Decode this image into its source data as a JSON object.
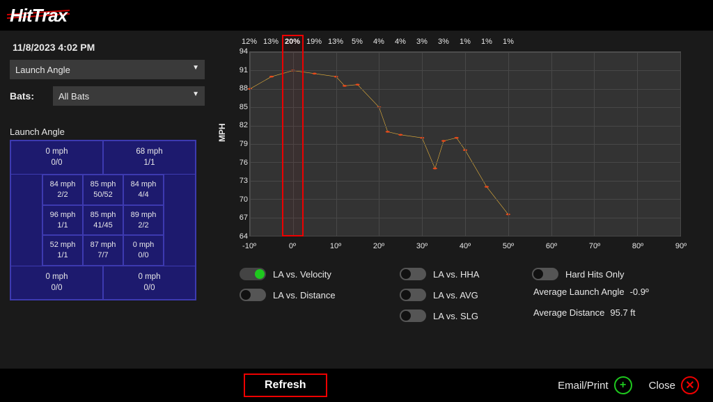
{
  "logo_text": "HitTrax",
  "timestamp": "11/8/2023 4:02 PM",
  "metric_select": "Launch Angle",
  "bats_label": "Bats:",
  "bats_select": "All Bats",
  "zone_title": "Launch Angle",
  "zone": {
    "top": [
      {
        "v": "0 mph",
        "c": "0/0"
      },
      {
        "v": "68 mph",
        "c": "1/1"
      }
    ],
    "inner": [
      [
        {
          "v": "84 mph",
          "c": "2/2"
        },
        {
          "v": "85 mph",
          "c": "50/52"
        },
        {
          "v": "84 mph",
          "c": "4/4"
        }
      ],
      [
        {
          "v": "96 mph",
          "c": "1/1"
        },
        {
          "v": "85 mph",
          "c": "41/45"
        },
        {
          "v": "89 mph",
          "c": "2/2"
        }
      ],
      [
        {
          "v": "52 mph",
          "c": "1/1"
        },
        {
          "v": "87 mph",
          "c": "7/7"
        },
        {
          "v": "0 mph",
          "c": "0/0"
        }
      ]
    ],
    "bottom": [
      {
        "v": "0 mph",
        "c": "0/0"
      },
      {
        "v": "0 mph",
        "c": "0/0"
      }
    ]
  },
  "toggles": {
    "la_velocity": "LA vs. Velocity",
    "la_distance": "LA vs. Distance",
    "la_hha": "LA vs. HHA",
    "la_avg": "LA vs. AVG",
    "la_slg": "LA vs. SLG",
    "hard_hits": "Hard Hits Only"
  },
  "stats": {
    "avg_la_label": "Average Launch Angle",
    "avg_la_value": "-0.9º",
    "avg_dist_label": "Average Distance",
    "avg_dist_value": "95.7 ft"
  },
  "footer": {
    "refresh": "Refresh",
    "email": "Email/Print",
    "close": "Close"
  },
  "chart_data": {
    "type": "line",
    "title": "",
    "ylabel": "MPH",
    "xlabel": "",
    "x_range": [
      -10,
      90
    ],
    "y_range": [
      64,
      94
    ],
    "x_ticks": [
      -10,
      0,
      10,
      20,
      30,
      40,
      50,
      60,
      70,
      80,
      90
    ],
    "y_ticks": [
      64,
      67,
      70,
      73,
      76,
      79,
      82,
      85,
      88,
      91,
      94
    ],
    "pct_labels": [
      {
        "x": -10,
        "label": "12%"
      },
      {
        "x": -5,
        "label": "13%"
      },
      {
        "x": 0,
        "label": "20%",
        "highlight": true
      },
      {
        "x": 5,
        "label": "19%"
      },
      {
        "x": 10,
        "label": "13%"
      },
      {
        "x": 15,
        "label": "5%"
      },
      {
        "x": 20,
        "label": "4%"
      },
      {
        "x": 25,
        "label": "4%"
      },
      {
        "x": 30,
        "label": "3%"
      },
      {
        "x": 35,
        "label": "3%"
      },
      {
        "x": 40,
        "label": "1%"
      },
      {
        "x": 45,
        "label": "1%"
      },
      {
        "x": 50,
        "label": "1%"
      }
    ],
    "highlight_x_range": [
      -2.5,
      2.5
    ],
    "series": [
      {
        "name": "Velocity",
        "color": "#e8b33c",
        "points": [
          {
            "x": -10,
            "y": 88
          },
          {
            "x": -5,
            "y": 90
          },
          {
            "x": 0,
            "y": 91
          },
          {
            "x": 5,
            "y": 90.5
          },
          {
            "x": 10,
            "y": 90
          },
          {
            "x": 12,
            "y": 88.5
          },
          {
            "x": 15,
            "y": 88.7
          },
          {
            "x": 20,
            "y": 85
          },
          {
            "x": 22,
            "y": 81
          },
          {
            "x": 25,
            "y": 80.5
          },
          {
            "x": 30,
            "y": 80
          },
          {
            "x": 33,
            "y": 75
          },
          {
            "x": 35,
            "y": 79.5
          },
          {
            "x": 38,
            "y": 80
          },
          {
            "x": 40,
            "y": 78
          },
          {
            "x": 45,
            "y": 72
          },
          {
            "x": 50,
            "y": 67.5
          }
        ]
      }
    ]
  }
}
